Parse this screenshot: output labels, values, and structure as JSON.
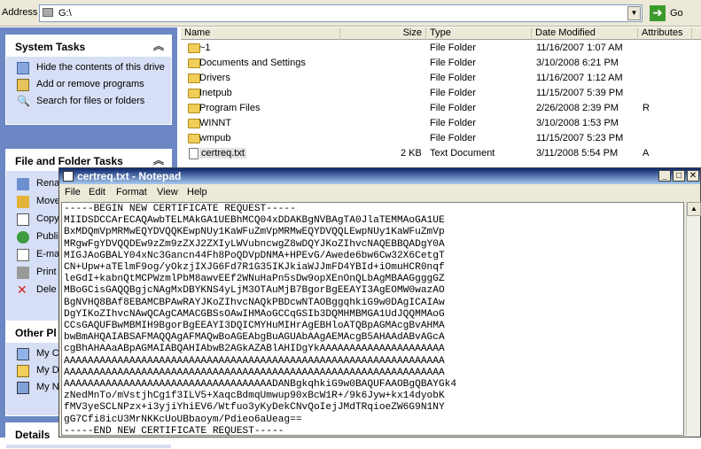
{
  "address_bar": {
    "label": "Address",
    "value": "G:\\",
    "go_label": "Go"
  },
  "task_pane": {
    "system_tasks": {
      "title": "System Tasks",
      "items": [
        {
          "label": "Hide the contents of this drive",
          "icon": "hide-drive-icon"
        },
        {
          "label": "Add or remove programs",
          "icon": "add-remove-programs-icon"
        },
        {
          "label": "Search for files or folders",
          "icon": "search-icon"
        }
      ]
    },
    "file_folder_tasks": {
      "title": "File and Folder Tasks",
      "items": [
        {
          "label": "Rena",
          "icon": "rename-icon"
        },
        {
          "label": "Move",
          "icon": "move-icon"
        },
        {
          "label": "Copy",
          "icon": "copy-icon"
        },
        {
          "label": "Publi",
          "icon": "publish-icon"
        },
        {
          "label": "E-ma",
          "icon": "email-icon"
        },
        {
          "label": "Print",
          "icon": "print-icon"
        },
        {
          "label": "Dele",
          "icon": "delete-icon"
        }
      ]
    },
    "other_places": {
      "title": "Other Pl",
      "items": [
        {
          "label": "My C",
          "icon": "my-computer-icon"
        },
        {
          "label": "My D",
          "icon": "my-documents-icon"
        },
        {
          "label": "My N",
          "icon": "my-network-icon"
        }
      ]
    },
    "details": {
      "title": "Details"
    }
  },
  "file_list": {
    "columns": {
      "name": "Name",
      "size": "Size",
      "type": "Type",
      "modified": "Date Modified",
      "attributes": "Attributes"
    },
    "rows": [
      {
        "name": "~1",
        "size": "",
        "type": "File Folder",
        "modified": "11/16/2007 1:07 AM",
        "attributes": ""
      },
      {
        "name": "Documents and Settings",
        "size": "",
        "type": "File Folder",
        "modified": "3/10/2008 6:21 PM",
        "attributes": ""
      },
      {
        "name": "Drivers",
        "size": "",
        "type": "File Folder",
        "modified": "11/16/2007 1:12 AM",
        "attributes": ""
      },
      {
        "name": "Inetpub",
        "size": "",
        "type": "File Folder",
        "modified": "11/15/2007 5:39 PM",
        "attributes": ""
      },
      {
        "name": "Program Files",
        "size": "",
        "type": "File Folder",
        "modified": "2/26/2008 2:39 PM",
        "attributes": "R"
      },
      {
        "name": "WINNT",
        "size": "",
        "type": "File Folder",
        "modified": "3/10/2008 1:53 PM",
        "attributes": ""
      },
      {
        "name": "wmpub",
        "size": "",
        "type": "File Folder",
        "modified": "11/15/2007 5:23 PM",
        "attributes": ""
      },
      {
        "name": "certreq.txt",
        "size": "2 KB",
        "type": "Text Document",
        "modified": "3/11/2008 5:54 PM",
        "attributes": "A"
      }
    ]
  },
  "notepad": {
    "title": "certreq.txt - Notepad",
    "menu": {
      "file": "File",
      "edit": "Edit",
      "format": "Format",
      "view": "View",
      "help": "Help"
    },
    "content": "-----BEGIN NEW CERTIFICATE REQUEST-----\nMIIDSDCCArECAQAwbTELMAkGA1UEBhMCQ04xDDAKBgNVBAgTA0JlaTEMMAoGA1UE\nBxMDQmVpMRMwEQYDVQQKEwpNUy1KaWFuZmVpMRMwEQYDVQQLEwpNUy1KaWFuZmVp\nMRgwFgYDVQQDEw9zZm9zZXJ2ZXIyLWVubncwgZ8wDQYJKoZIhvcNAQEBBQADgY0A\nMIGJAoGBALY04xNc3Gancn44Fh8PoQDVpDNMA+HPEvG/Awede6bw6Cw32X6CetgT\nCN+Upw+aTElmF9og/yOkzjIXJG6Fd7R1G35IKJkiaWJJmFD4YBId+iOmuHCR0nqf\nleGdI+kabnQtMCPWzmlPbM8awvEEf2WNuHaPn5sDw9opXEnOnQLbAgMBAAGgggGZ\nMBoGCisGAQQBgjcNAgMxDBYKNS4yLjM3OTAuMjB7BgorBgEEAYI3AgEOMW0wazAO\nBgNVHQ8BAf8EBAMCBPAwRAYJKoZIhvcNAQkPBDcwNTAOBggqhkiG9w0DAgICAIAw\nDgYIKoZIhvcNAwQCAgCAMACGBSsOAwIHMAoGCCqGSIb3DQMHMBMGA1UdJQQMMAoG\nCCsGAQUFBwMBMIH9BgorBgEEAYI3DQICMYHuMIHrAgEBHloATQBpAGMAcgBvAHMA\nbwBmAHQAIABSAFMAQQAgAFMAQwBoAGEAbgBuAGUAbAAgAEMAcgB5AHAAdABvAGcA\ncgBhAHAAaABpAGMAIABQAHIAbwB2AGkAZABlAHIDgYkAAAAAAAAAAAAAAAAAAAAA\nAAAAAAAAAAAAAAAAAAAAAAAAAAAAAAAAAAAAAAAAAAAAAAAAAAAAAAAAAAAAAAAA\nAAAAAAAAAAAAAAAAAAAAAAAAAAAAAAAAAAAAAAAAAAAAAAAAAAAAAAAAAAAAAAAA\nAAAAAAAAAAAAAAAAAAAAAAAAAAAAAAAAAAADANBgkqhkiG9w0BAQUFAAOBgQBAYGk4\nzNedMnTo/mVstjhCg1f3ILV5+XaqcBdmqUmwup90xBcW1R+/9k6Jyw+kx14dyobK\nfMV3yeSCLNPzx+i3yjiYhiEV6/Wtfuo3yKyDekCNvQoIejJMdTRqioeZW6G9N1NY\ngG7Cfi8icU3MrNKKcUoUBbaoym/Pdieo6aUeag==\n-----END NEW CERTIFICATE REQUEST-----"
  }
}
